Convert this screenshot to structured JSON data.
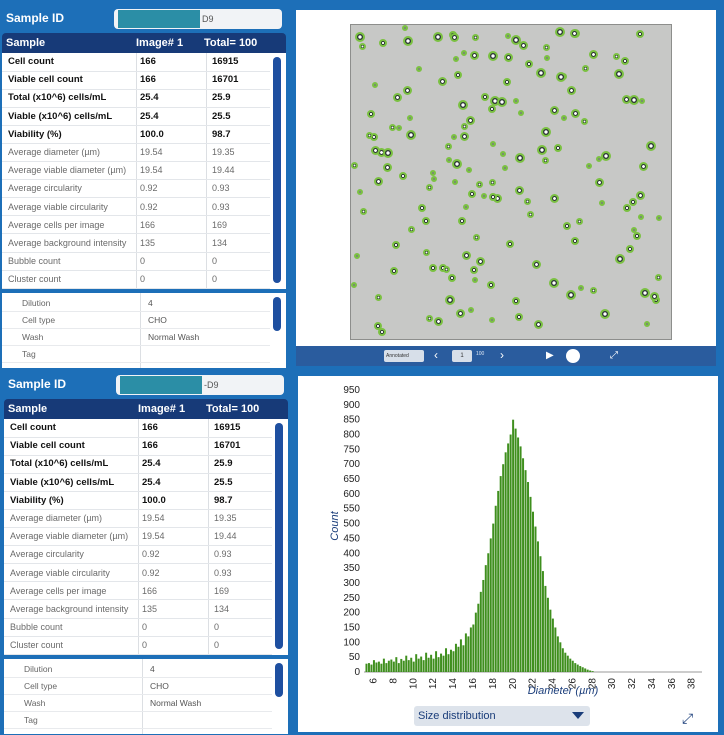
{
  "sample_id_label": "Sample ID",
  "sample_id_suffix_top": "D9",
  "sample_id_suffix_bottom": "-D9",
  "table_header": {
    "sample": "Sample",
    "image_no": "Image# 1",
    "total": "Total= 100"
  },
  "rows": [
    {
      "label": "Cell count",
      "image": "166",
      "total": "16915",
      "style": "bold"
    },
    {
      "label": "Viable cell count",
      "image": "166",
      "total": "16701",
      "style": "bold"
    },
    {
      "label": "Total (x10^6) cells/mL",
      "image": "25.4",
      "total": "25.9",
      "style": "bold"
    },
    {
      "label": "Viable (x10^6) cells/mL",
      "image": "25.4",
      "total": "25.5",
      "style": "bold"
    },
    {
      "label": "Viability (%)",
      "image": "100.0",
      "total": "98.7",
      "style": "bold"
    },
    {
      "label": "Average diameter (µm)",
      "image": "19.54",
      "total": "19.35",
      "style": "light"
    },
    {
      "label": "Average viable diameter (µm)",
      "image": "19.54",
      "total": "19.44",
      "style": "light"
    },
    {
      "label": "Average circularity",
      "image": "0.92",
      "total": "0.93",
      "style": "light"
    },
    {
      "label": "Average viable circularity",
      "image": "0.92",
      "total": "0.93",
      "style": "light"
    },
    {
      "label": "Average cells per image",
      "image": "166",
      "total": "169",
      "style": "light"
    },
    {
      "label": "Average background intensity",
      "image": "135",
      "total": "134",
      "style": "light"
    },
    {
      "label": "Bubble count",
      "image": "0",
      "total": "0",
      "style": "light"
    },
    {
      "label": "Cluster count",
      "image": "0",
      "total": "0",
      "style": "light"
    }
  ],
  "meta_rows": [
    {
      "label": "Dilution",
      "value": "4"
    },
    {
      "label": "Cell type",
      "value": "CHO"
    },
    {
      "label": "Wash",
      "value": "Normal Wash"
    },
    {
      "label": "Tag",
      "value": ""
    }
  ],
  "image_controls": {
    "view_mode": "Annotated",
    "page": "1",
    "page_total": "100",
    "prev_icon": "chevron-left-icon",
    "next_icon": "chevron-right-icon",
    "play_icon": "play-icon",
    "expand_icon": "expand-icon"
  },
  "chart_dropdown": "Size distribution",
  "colors": {
    "accent": "#1d6fb8",
    "header": "#173a78",
    "bars": "#3f8f1e",
    "cell_ring": "#7bc142"
  },
  "chart_data": {
    "type": "bar",
    "title": "",
    "xlabel": "Diameter (µm)",
    "ylabel": "Count",
    "ylim": [
      0,
      950
    ],
    "xlim": [
      5,
      39
    ],
    "yticks": [
      0,
      50,
      100,
      150,
      200,
      250,
      300,
      350,
      400,
      450,
      500,
      550,
      600,
      650,
      700,
      750,
      800,
      850,
      900,
      950
    ],
    "xticks": [
      6,
      8,
      10,
      12,
      14,
      16,
      18,
      20,
      22,
      24,
      26,
      28,
      30,
      32,
      34,
      36,
      38
    ],
    "grid": false,
    "x": [
      5.25,
      5.5,
      5.75,
      6.0,
      6.25,
      6.5,
      6.75,
      7.0,
      7.25,
      7.5,
      7.75,
      8.0,
      8.25,
      8.5,
      8.75,
      9.0,
      9.25,
      9.5,
      9.75,
      10.0,
      10.25,
      10.5,
      10.75,
      11.0,
      11.25,
      11.5,
      11.75,
      12.0,
      12.25,
      12.5,
      12.75,
      13.0,
      13.25,
      13.5,
      13.75,
      14.0,
      14.25,
      14.5,
      14.75,
      15.0,
      15.25,
      15.5,
      15.75,
      16.0,
      16.25,
      16.5,
      16.75,
      17.0,
      17.25,
      17.5,
      17.75,
      18.0,
      18.25,
      18.5,
      18.75,
      19.0,
      19.25,
      19.5,
      19.75,
      20.0,
      20.25,
      20.5,
      20.75,
      21.0,
      21.25,
      21.5,
      21.75,
      22.0,
      22.25,
      22.5,
      22.75,
      23.0,
      23.25,
      23.5,
      23.75,
      24.0,
      24.25,
      24.5,
      24.75,
      25.0,
      25.25,
      25.5,
      25.75,
      26.0,
      26.25,
      26.5,
      26.75,
      27.0,
      27.25,
      27.5,
      27.75,
      28.0
    ],
    "values": [
      28,
      30,
      25,
      40,
      32,
      35,
      28,
      45,
      30,
      38,
      42,
      35,
      50,
      30,
      44,
      38,
      55,
      40,
      48,
      35,
      60,
      45,
      52,
      40,
      65,
      48,
      58,
      45,
      70,
      50,
      62,
      55,
      80,
      60,
      75,
      70,
      95,
      85,
      110,
      90,
      130,
      120,
      150,
      160,
      200,
      230,
      270,
      310,
      360,
      400,
      450,
      500,
      560,
      610,
      660,
      700,
      740,
      770,
      800,
      850,
      820,
      790,
      760,
      720,
      680,
      640,
      590,
      540,
      490,
      440,
      390,
      340,
      290,
      250,
      210,
      180,
      150,
      120,
      100,
      80,
      65,
      55,
      45,
      38,
      30,
      25,
      20,
      16,
      12,
      8,
      5,
      3
    ]
  }
}
